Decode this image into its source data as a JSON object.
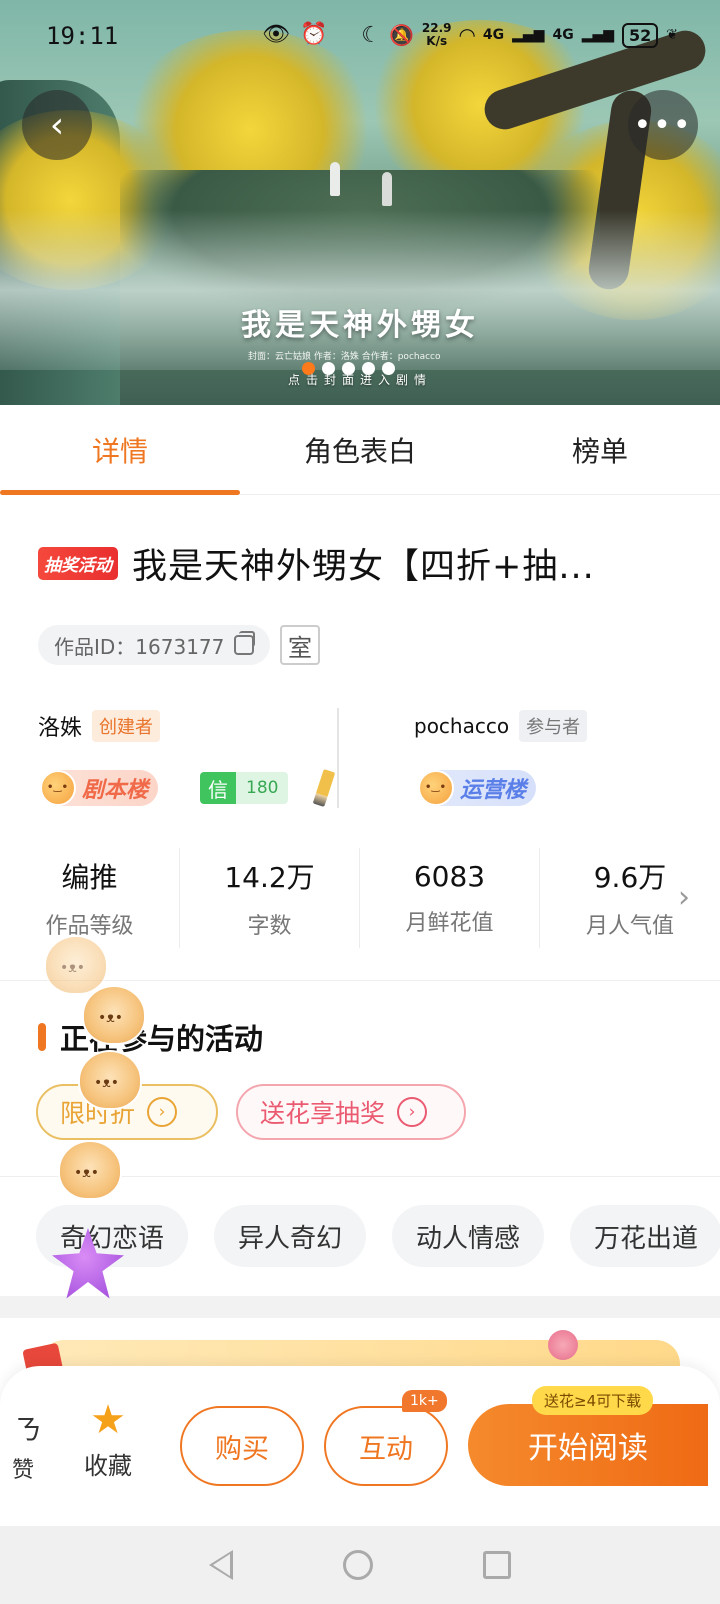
{
  "status_bar": {
    "time": "19:11",
    "speed_value": "22.9",
    "speed_unit": "K/s",
    "net1": "4G",
    "net2": "4G",
    "battery": "52"
  },
  "banner": {
    "title": "我是天神外甥女",
    "credits": "封面：云亡姑娘    作者：洛姝  合作者：pochacco",
    "hint": "点击封面进入剧情",
    "slides": 6,
    "active_slide": 0
  },
  "tabs": [
    {
      "label": "详情",
      "active": true
    },
    {
      "label": "角色表白",
      "active": false
    },
    {
      "label": "榜单",
      "active": false
    }
  ],
  "work": {
    "tag": "抽奖活动",
    "title": "我是天神外甥女【四折+抽...",
    "id_text": "作品ID：1673177",
    "room_label": "室"
  },
  "creators": {
    "creator_name": "洛姝",
    "creator_badge": "创建者",
    "participant_name": "pochacco",
    "participant_badge": "参与者",
    "pill_juben": "剧本楼",
    "pill_yunying": "运营楼",
    "xin_label": "信",
    "xin_value": "180"
  },
  "stats": [
    {
      "value": "编推",
      "label": "作品等级"
    },
    {
      "value": "14.2万",
      "label": "字数"
    },
    {
      "value": "6083",
      "label": "月鲜花值"
    },
    {
      "value": "9.6万",
      "label": "月人气值"
    }
  ],
  "activities": {
    "title": "正在参与的活动",
    "items": [
      "限时折",
      "送花享抽奖"
    ]
  },
  "genres": [
    "奇幻恋语",
    "异人奇幻",
    "动人情感",
    "万花出道"
  ],
  "bottom": {
    "like": "赞",
    "favorite": "收藏",
    "buy": "购买",
    "interact": "互动",
    "interact_badge": "1k+",
    "read": "开始阅读",
    "read_tip": "送花≥4可下载"
  },
  "colors": {
    "accent": "#f07722",
    "lottery_tag": "#e92f2f"
  }
}
